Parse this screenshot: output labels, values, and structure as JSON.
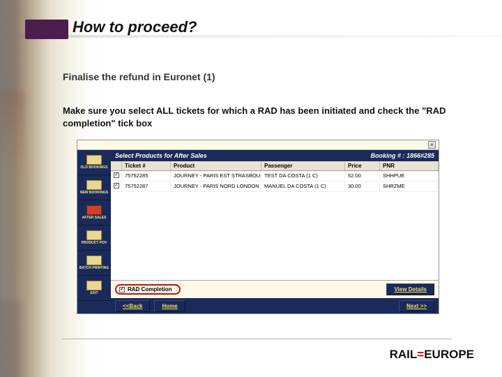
{
  "title": "How to proceed?",
  "subtitle": "Finalise the refund in Euronet (1)",
  "body": "Make sure you select ALL tickets for which a RAD has been initiated and check the \"RAD completion\" tick box",
  "win": {
    "section_label": "Select Products for After Sales",
    "booking_label": "Booking # : 1866#285",
    "headers": {
      "ticket": "Ticket #",
      "product": "Product",
      "passenger": "Passenger",
      "price": "Price",
      "pnr": "PNR"
    },
    "rows": [
      {
        "checked": true,
        "ticket": "75752285",
        "product": "JOURNEY - PARIS EST STRASBOURG",
        "passenger": "TEST DA COSTA (1 C)",
        "price": "52.00",
        "pnr": "SHHPUE"
      },
      {
        "checked": true,
        "ticket": "75752287",
        "product": "JOURNEY - PARIS NORD LONDON ST PANCRAS",
        "passenger": "MANUEL DA COSTA (1 C)",
        "price": "30.00",
        "pnr": "SHRZME"
      }
    ],
    "rad_label": "RAD Completion",
    "view_details": "View Details",
    "back": "<<Back",
    "home": "Home",
    "next": "Next >>"
  },
  "sidebar": [
    {
      "label": "OLD BOOKINGS"
    },
    {
      "label": "NEW BOOKINGS"
    },
    {
      "label": "AFTER SALES"
    },
    {
      "label": "PRODUCT POV"
    },
    {
      "label": "BATCH PRINTING"
    },
    {
      "label": "EXIT"
    }
  ],
  "logo": {
    "pre": "RAIL",
    "eq": "=",
    "post": "EUROPE"
  }
}
